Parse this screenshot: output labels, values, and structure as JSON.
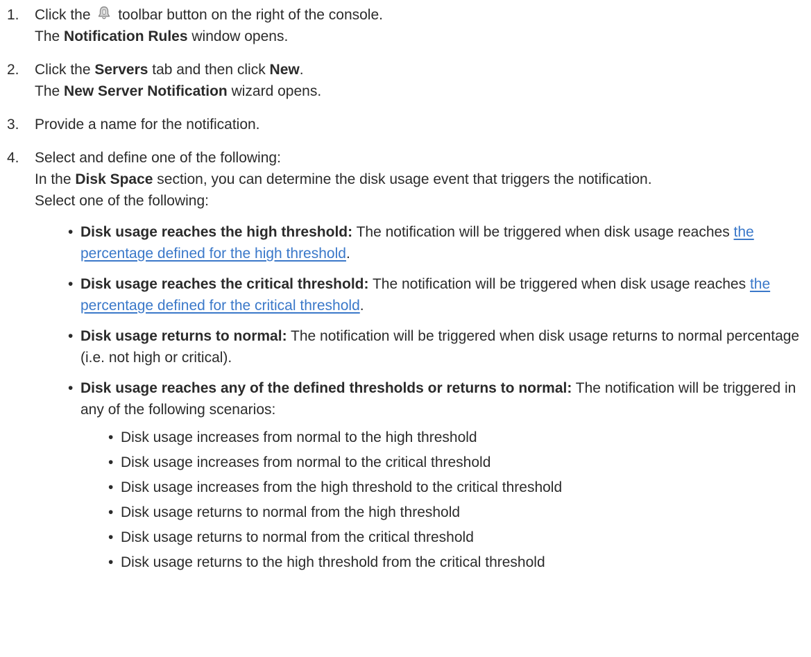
{
  "steps": [
    {
      "num": "1.",
      "pre": "Click the",
      "icon": "bell-icon",
      "post": "toolbar button on the right of the console.",
      "result_pre": "The ",
      "result_bold": "Notification Rules",
      "result_post": " window opens."
    },
    {
      "num": "2.",
      "t1": "Click the ",
      "b1": "Servers",
      "t2": " tab and then click ",
      "b2": "New",
      "t3": ".",
      "result_pre": "The ",
      "result_bold": "New Server Notification",
      "result_post": " wizard opens."
    },
    {
      "num": "3.",
      "text": "Provide a name for the notification."
    },
    {
      "num": "4.",
      "text": "Select and define one of the following:",
      "para_pre": "In the ",
      "para_bold": "Disk Space",
      "para_post": " section, you can determine the disk usage event that triggers the notification.",
      "select_text": "Select one of the following:",
      "options": [
        {
          "bold": "Disk usage reaches the high threshold:",
          "pre": " The notification will be triggered when disk usage reaches ",
          "link": "the percentage defined for the high threshold",
          "post": "."
        },
        {
          "bold": "Disk usage reaches the critical threshold:",
          "pre": " The notification will be triggered when disk usage reaches ",
          "link": "the percentage defined for the critical threshold",
          "post": "."
        },
        {
          "bold": "Disk usage returns to normal:",
          "text": " The notification will be triggered when disk usage returns to normal percentage (i.e. not high or critical)."
        },
        {
          "bold": "Disk usage reaches any of the defined thresholds or returns to normal:",
          "text": " The notification will be triggered in any of the following scenarios:",
          "scenarios": [
            "Disk usage increases from normal to the high threshold",
            "Disk usage increases from normal to the critical threshold",
            "Disk usage increases from the high threshold to the critical threshold",
            "Disk usage returns to normal from the high threshold",
            "Disk usage returns to normal from the critical threshold",
            "Disk usage returns to the high threshold from the critical threshold"
          ]
        }
      ]
    }
  ],
  "colors": {
    "text": "#2b2b2b",
    "link": "#3a78c9"
  }
}
